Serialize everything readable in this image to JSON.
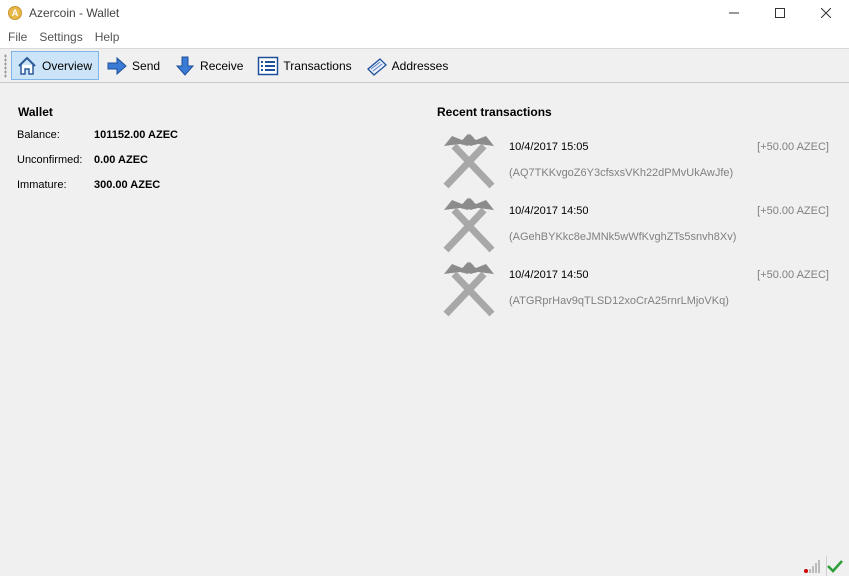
{
  "window": {
    "title": "Azercoin - Wallet",
    "controls": [
      "minimize-icon",
      "maximize-icon",
      "close-icon"
    ]
  },
  "menu": [
    {
      "label": "File"
    },
    {
      "label": "Settings"
    },
    {
      "label": "Help"
    }
  ],
  "toolbar": [
    {
      "label": "Overview",
      "icon": "home-icon",
      "active": true
    },
    {
      "label": "Send",
      "icon": "send-arrow-icon",
      "active": false
    },
    {
      "label": "Receive",
      "icon": "receive-arrow-icon",
      "active": false
    },
    {
      "label": "Transactions",
      "icon": "list-icon",
      "active": false
    },
    {
      "label": "Addresses",
      "icon": "address-book-icon",
      "active": false
    }
  ],
  "wallet": {
    "title": "Wallet",
    "balance_label": "Balance:",
    "balance_value": "101152.00 AZEC",
    "unconfirmed_label": "Unconfirmed:",
    "unconfirmed_value": "0.00 AZEC",
    "immature_label": "Immature:",
    "immature_value": "300.00 AZEC"
  },
  "recent": {
    "title": "Recent transactions",
    "items": [
      {
        "date": "10/4/2017 15:05",
        "amount": "[+50.00 AZEC]",
        "address": "(AQ7TKKvgoZ6Y3cfsxsVKh22dPMvUkAwJfe)",
        "icon": "mining-hammers-icon"
      },
      {
        "date": "10/4/2017 14:50",
        "amount": "[+50.00 AZEC]",
        "address": "(AGehBYKkc8eJMNk5wWfKvghZTs5snvh8Xv)",
        "icon": "mining-hammers-icon"
      },
      {
        "date": "10/4/2017 14:50",
        "amount": "[+50.00 AZEC]",
        "address": "(ATGRprHav9qTLSD12xoCrA25rnrLMjoVKq)",
        "icon": "mining-hammers-icon"
      }
    ]
  },
  "status": {
    "icons": [
      "network-signal-icon",
      "synced-checkmark-icon"
    ],
    "colors": {
      "synced": "#2e9e3a",
      "signal_dot": "#cc0000"
    }
  }
}
